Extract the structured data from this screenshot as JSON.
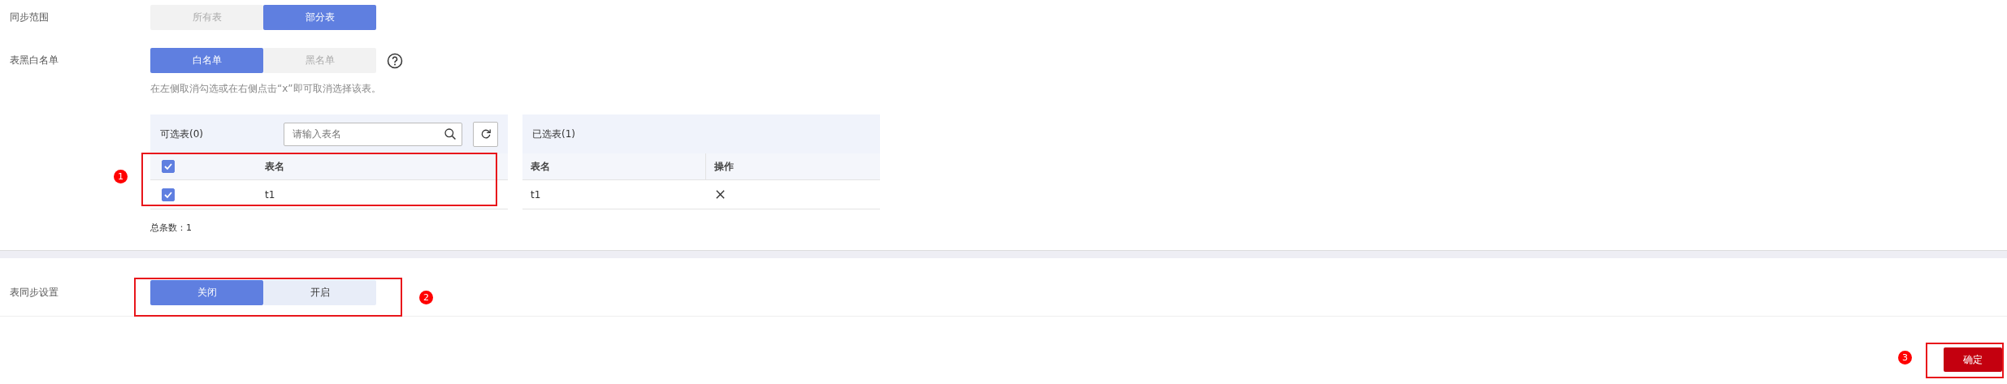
{
  "sync_scope": {
    "label": "同步范围",
    "options": [
      {
        "label": "所有表",
        "selected": false
      },
      {
        "label": "部分表",
        "selected": true
      }
    ]
  },
  "table_list_type": {
    "label": "表黑白名单",
    "options": [
      {
        "label": "白名单",
        "selected": true
      },
      {
        "label": "黑名单",
        "selected": false
      }
    ],
    "hint": "在左侧取消勾选或在右侧点击“x”即可取消选择该表。"
  },
  "available_tables": {
    "title": "可选表(0)",
    "search": {
      "placeholder": "请输入表名"
    },
    "header": {
      "checked": true,
      "column": "表名"
    },
    "rows": [
      {
        "checked": true,
        "name": "t1"
      }
    ],
    "total": "总条数：1"
  },
  "selected_tables": {
    "title": "已选表(1)",
    "columns": [
      "表名",
      "操作"
    ],
    "rows": [
      {
        "name": "t1"
      }
    ]
  },
  "table_sync": {
    "label": "表同步设置",
    "options": [
      {
        "label": "关闭",
        "selected": true
      },
      {
        "label": "开启",
        "selected": false
      }
    ]
  },
  "confirm_button": "确定",
  "markers": [
    "1",
    "2",
    "3"
  ]
}
